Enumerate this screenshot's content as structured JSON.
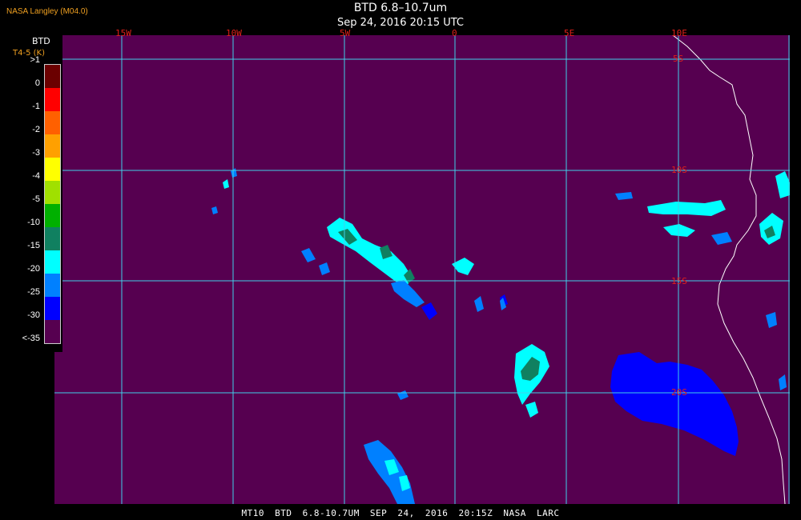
{
  "header": {
    "title": "BTD 6.8–10.7um",
    "datetime": "Sep 24, 2016 20:15 UTC",
    "agency": "NASA Langley (M04.0)"
  },
  "legend": {
    "title": "BTD",
    "subtitle": "T4-5 (K)",
    "ticks": [
      ">1",
      "0",
      "-1",
      "-2",
      "-3",
      "-4",
      "-5",
      "-10",
      "-15",
      "-20",
      "-25",
      "-30",
      "<-35"
    ],
    "colors": [
      "#6b0000",
      "#ff0000",
      "#ff6000",
      "#ffa000",
      "#ffff00",
      "#a0e000",
      "#00b000",
      "#108060",
      "#00ffff",
      "#0080ff",
      "#0000ff",
      "#560050"
    ]
  },
  "map": {
    "background_color": "#560050",
    "grid_color": "#40d0e8",
    "lon_labels": [
      "15W",
      "10W",
      "5W",
      "0",
      "5E",
      "10E"
    ],
    "lat_labels": [
      "5S",
      "10S",
      "15S",
      "20S"
    ]
  },
  "footer": {
    "text": "MT10   BTD 6.8-10.7UM   SEP 24, 2016 20:15Z   NASA LARC"
  }
}
